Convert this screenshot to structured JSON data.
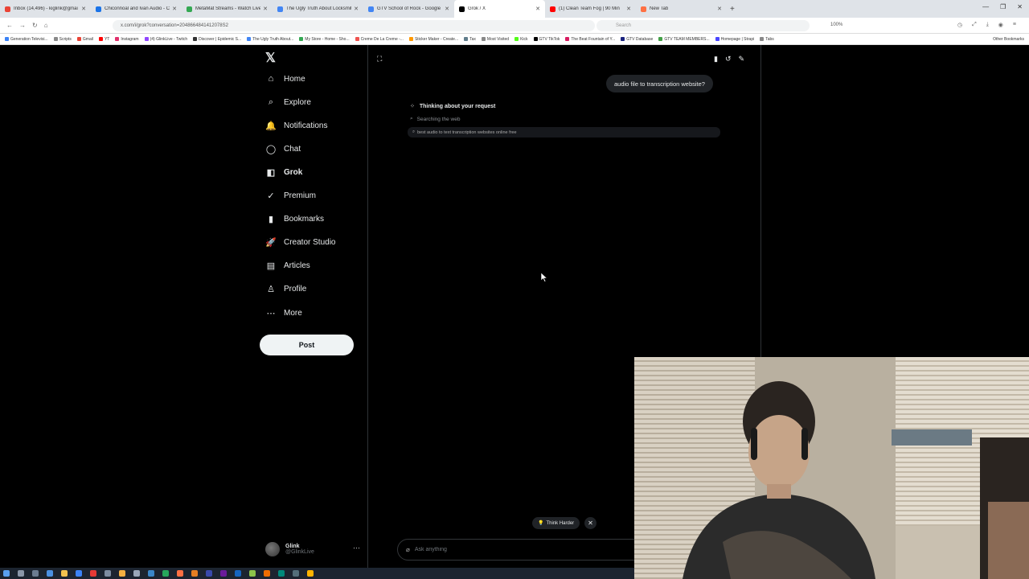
{
  "browser": {
    "tabs": [
      {
        "label": "Inbox (14,496) - kiglink@gmai",
        "color": "#ea4335"
      },
      {
        "label": "Chiconnoal and Ivan Audio - Co",
        "color": "#1a73e8"
      },
      {
        "label": "MetaMat Streams - Watch Live o",
        "color": "#34a853"
      },
      {
        "label": "The Ugly Truth About Locksmit",
        "color": "#4285f4"
      },
      {
        "label": "GTV School of Rock - Google D",
        "color": "#4285f4"
      },
      {
        "label": "Grok / X",
        "color": "#000000",
        "active": true
      },
      {
        "label": "(1) Clean Team Fog | 90 Min",
        "color": "#ff0000"
      },
      {
        "label": "New Tab",
        "color": "#ff7043"
      }
    ],
    "url": "x.com/i/grok?conversation=2048664841412078S2",
    "search_placeholder": "Search",
    "zoom": "100%",
    "bookmarks": [
      "Generation Televisi...",
      "Scripts",
      "Gmail",
      "YT",
      "Instagram",
      "(4) GlinkLive - Twitch",
      "Discover | Epidemic S...",
      "The Ugly Truth About...",
      "My Store - Home - Sho...",
      "Creme De La Creme -...",
      "Sticker Maker - Create...",
      "Tax",
      "Most Visited",
      "Kick",
      "GTV TikTok",
      "The Beat Fountain of Y...",
      "GTV Database",
      "GTV TEAM MEMBERS...",
      "Homepage | Strapi",
      "Tabs"
    ],
    "other_bookmarks": "Other Bookmarks"
  },
  "sidebar": {
    "logo": "𝕏",
    "items": [
      {
        "label": "Home",
        "icon": "home-icon"
      },
      {
        "label": "Explore",
        "icon": "search-icon"
      },
      {
        "label": "Notifications",
        "icon": "bell-icon"
      },
      {
        "label": "Chat",
        "icon": "chat-icon"
      },
      {
        "label": "Grok",
        "icon": "grok-icon",
        "active": true
      },
      {
        "label": "Premium",
        "icon": "verified-icon"
      },
      {
        "label": "Bookmarks",
        "icon": "bookmark-icon"
      },
      {
        "label": "Creator Studio",
        "icon": "rocket-icon"
      },
      {
        "label": "Articles",
        "icon": "article-icon"
      },
      {
        "label": "Profile",
        "icon": "person-icon"
      },
      {
        "label": "More",
        "icon": "more-icon"
      }
    ],
    "post_label": "Post",
    "profile": {
      "name": "Glink",
      "handle": "@GlinkLive"
    }
  },
  "grok": {
    "user_message": "audio file to transcription website?",
    "thinking_label": "Thinking about your request",
    "searching_label": "Searching the web",
    "search_query": "best audio to text transcription websites online free",
    "think_harder_label": "Think Harder",
    "ask_placeholder": "Ask anything"
  }
}
